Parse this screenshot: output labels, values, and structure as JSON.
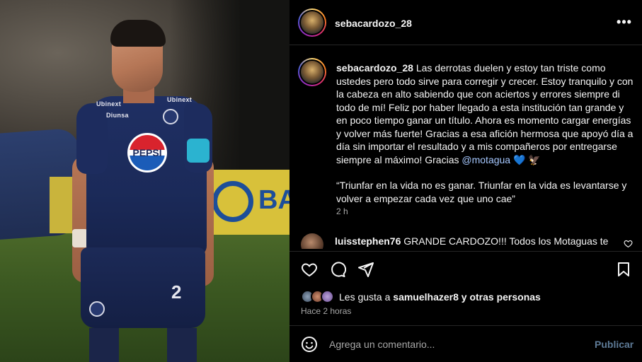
{
  "photo": {
    "jersey_sponsor": "PEPSI",
    "chest_sponsor": "Diunsa",
    "sleeve_sponsor": "Ubinext",
    "shorts_number": "2",
    "stadium_board_text": "BA"
  },
  "post": {
    "username": "sebacardozo_28",
    "more_icon": "more-horizontal-icon",
    "caption_text": "Las derrotas duelen y estoy tan triste como ustedes pero todo sirve para corregir y crecer. Estoy tranquilo y con la cabeza en alto sabiendo que con aciertos y errores siempre di todo de mí! Feliz por haber llegado a esta institución tan grande y en poco tiempo ganar un título. Ahora es momento cargar energías y volver más fuerte! Gracias a esa afición hermosa que apoyó día a día sin importar el resultado y a mis compañeros por entregarse siempre al máximo! Gracias",
    "mention": "@motagua",
    "emojis": "💙 🦅",
    "quote": "“Triunfar en la vida no es ganar. Triunfar en la vida es levantarse y volver a empezar cada vez que uno cae”",
    "caption_time": "2 h"
  },
  "comment": {
    "username": "luisstephen76",
    "text": "GRANDE CARDOZO!!! Todos los Motaguas te"
  },
  "actions": {
    "like_icon": "heart-icon",
    "comment_icon": "comment-icon",
    "share_icon": "send-icon",
    "save_icon": "bookmark-icon"
  },
  "likes": {
    "prefix": "Les gusta a",
    "user": "samuelhazer8",
    "suffix": "y otras personas",
    "time_ago": "Hace 2 horas"
  },
  "add_comment": {
    "emoji_icon": "emoji-icon",
    "placeholder": "Agrega un comentario...",
    "publish_label": "Publicar"
  },
  "colors": {
    "background": "#000000",
    "text": "#f5f5f5",
    "muted": "#a8a8a8",
    "mention": "#a6c8ff",
    "publish_disabled": "#5d7a96",
    "divider": "#262626"
  }
}
